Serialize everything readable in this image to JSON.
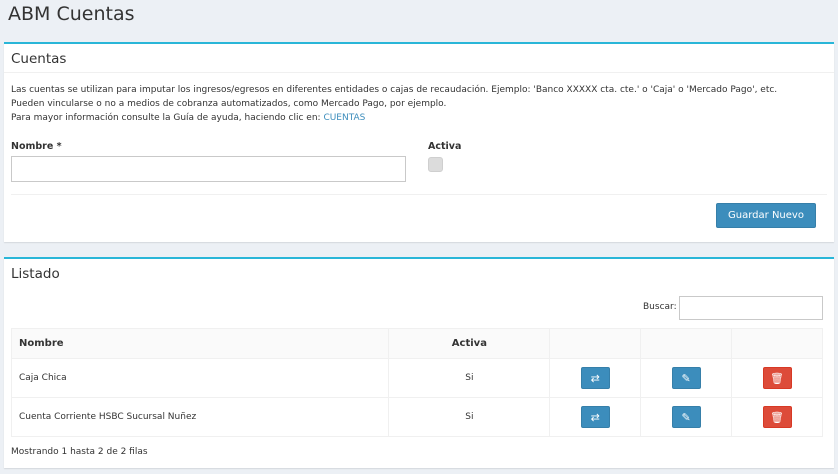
{
  "page": {
    "title": "ABM Cuentas"
  },
  "form": {
    "title": "Cuentas",
    "description_line1": "Las cuentas se utilizan para imputar los ingresos/egresos en diferentes entidades o cajas de recaudación. Ejemplo: 'Banco XXXXX cta. cte.' o 'Caja' o 'Mercado Pago', etc.",
    "description_line2": "Pueden vincularse o no a medios de cobranza automatizados, como Mercado Pago, por ejemplo.",
    "description_line3_prefix": "Para mayor información consulte la Guía de ayuda, haciendo clic en:",
    "help_link": "CUENTAS",
    "nombre_label": "Nombre *",
    "nombre_value": "",
    "activa_label": "Activa",
    "activa_checked": false,
    "save_button": "Guardar Nuevo"
  },
  "listado": {
    "title": "Listado",
    "search_label": "Buscar:",
    "search_value": "",
    "columns": {
      "nombre": "Nombre",
      "activa": "Activa"
    },
    "rows": [
      {
        "nombre": "Caja Chica",
        "activa": "Si"
      },
      {
        "nombre": "Cuenta Corriente HSBC Sucursal Nuñez",
        "activa": "Si"
      }
    ],
    "footer": "Mostrando 1 hasta 2 de 2 filas"
  },
  "colors": {
    "accent": "#29b6d8",
    "primary": "#3c8dbc",
    "danger": "#dd4b39"
  },
  "icons": {
    "transfer": "exchange-icon",
    "edit": "edit-icon",
    "delete": "trash-icon"
  }
}
